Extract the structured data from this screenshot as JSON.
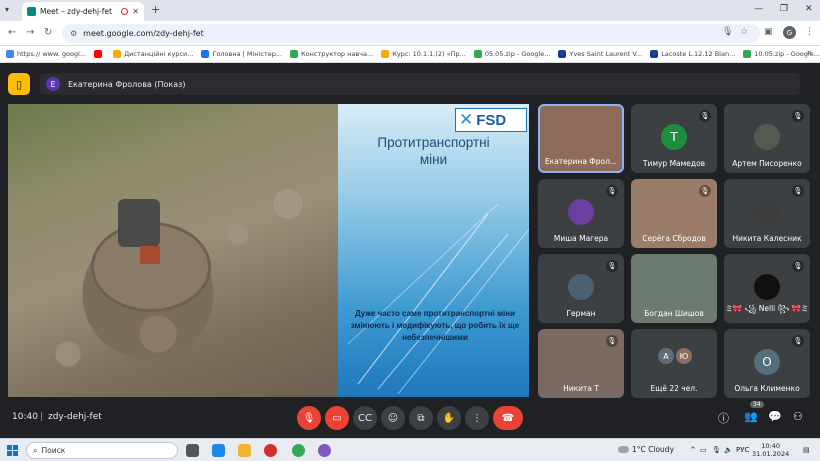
{
  "browser": {
    "tab_title": "Meet – zdy-dehj-fet",
    "url": "meet.google.com/zdy-dehj-fet",
    "profile_initial": "G",
    "bookmarks": [
      {
        "label": "https:// www. googl...",
        "color": "#4285f4"
      },
      {
        "label": "",
        "color": "#ff0000"
      },
      {
        "label": "Дистанційні курси...",
        "color": "#f9ab00"
      },
      {
        "label": "Головна | Міністер...",
        "color": "#1a73e8"
      },
      {
        "label": "Конструктор навча...",
        "color": "#34a853"
      },
      {
        "label": "Курс: 10.1.1.(2) «Пр...",
        "color": "#f9ab00"
      },
      {
        "label": "05.05.zip - Google...",
        "color": "#34a853"
      },
      {
        "label": "Yves Saint Laurent V...",
        "color": "#1a3d8f"
      },
      {
        "label": "Lacoste L.12.12 Blan...",
        "color": "#1a3d8f"
      },
      {
        "label": "10.05.zip - Google...",
        "color": "#34a853"
      }
    ]
  },
  "meeting": {
    "presenter_initial": "Е",
    "presenter_label": "Екатерина Фролова (Показ)",
    "time": "10:40",
    "separator": "|",
    "code": "zdy-dehj-fet",
    "participants_badge": "34"
  },
  "slide": {
    "logo": "FSD",
    "title_line1": "Протитранспортні",
    "title_line2": "міни",
    "body": "Дуже часто саме протитранспортні міни змінюють і модифікують, що робить їх ще небезпечнішими"
  },
  "participants": [
    {
      "name": "Екатерина Фрол...",
      "initial": "",
      "color": "#8e6b5a",
      "muted": false,
      "active": true
    },
    {
      "name": "Тимур Мамедов",
      "initial": "Т",
      "color": "#1e8e3e",
      "muted": true,
      "active": false
    },
    {
      "name": "Артем Писоренко",
      "initial": "",
      "color": "#555a50",
      "muted": true,
      "active": false
    },
    {
      "name": "Миша Магера",
      "initial": "",
      "color": "#6a3fa0",
      "muted": true,
      "active": false
    },
    {
      "name": "Серёга Сбродов",
      "initial": "",
      "color": "#9a7c68",
      "muted": true,
      "active": false
    },
    {
      "name": "Никита Калесник",
      "initial": "",
      "color": "#3d3d3d",
      "muted": true,
      "active": false
    },
    {
      "name": "Герман",
      "initial": "",
      "color": "#4b6070",
      "muted": true,
      "active": false
    },
    {
      "name": "Богдан Шишов",
      "initial": "",
      "color": "#6d7a70",
      "muted": false,
      "active": false
    },
    {
      "name": "ミ🎀 ꧁ Nelli ꧂ 🎀ミ",
      "initial": "",
      "color": "#111111",
      "muted": true,
      "active": false
    },
    {
      "name": "Никита Т",
      "initial": "",
      "color": "#7a6a62",
      "muted": true,
      "active": false
    },
    {
      "name": "Ещё 22 чел.",
      "initial": "",
      "color": "",
      "muted": false,
      "active": false
    },
    {
      "name": "Ольга Клименко",
      "initial": "О",
      "color": "#546e7a",
      "muted": true,
      "active": false
    }
  ],
  "more_avatars": [
    {
      "initial": "А",
      "color": "#5f6d7a"
    },
    {
      "initial": "Ю",
      "color": "#8d6e63"
    }
  ],
  "taskbar": {
    "search_placeholder": "Поиск",
    "weather": "1°C Cloudy",
    "language": "РУС",
    "time": "10:40",
    "date": "31.01.2024"
  }
}
